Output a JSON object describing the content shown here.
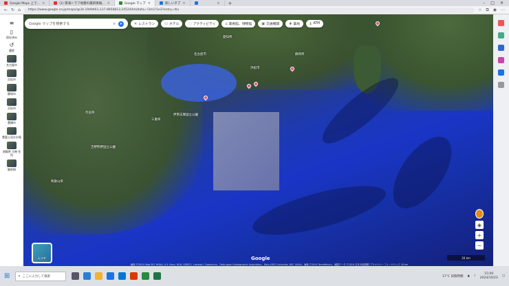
{
  "browser": {
    "tabs": [
      {
        "title": "Google Maps 上で…",
        "active": false,
        "color": "#d33333"
      },
      {
        "title": "(1) 南海トラフ地震の最新情報…",
        "active": false,
        "color": "#d33333"
      },
      {
        "title": "Google マップ",
        "active": true,
        "color": "#2b8a3e"
      },
      {
        "title": "新しいタブ",
        "active": false,
        "color": "#1a73e8"
      },
      {
        "title": "",
        "active": false,
        "color": "#1a73e8"
      }
    ],
    "new_tab": "+",
    "url": "https://www.google.co.jp/maps/@34.1949461,137.8958812,245244m/data=!3m1!1e3?entry=ttu",
    "nav": {
      "back": "←",
      "reload": "↻",
      "home": "⌂"
    },
    "window_controls": {
      "minimize": "–",
      "maximize": "□",
      "close": "✕"
    }
  },
  "sidebar": {
    "menu_icon": "≡",
    "items": [
      {
        "label": "保存済み",
        "icon": "bookmark"
      },
      {
        "label": "履歴",
        "icon": "history"
      },
      {
        "label": "名古屋市",
        "icon": "thumb"
      },
      {
        "label": "浜松市",
        "icon": "thumb"
      },
      {
        "label": "静岡市",
        "icon": "thumb"
      },
      {
        "label": "浜松市",
        "icon": "thumb"
      },
      {
        "label": "豊橋市",
        "icon": "thumb"
      },
      {
        "label": "豊富士見おお尾",
        "icon": "thumb"
      },
      {
        "label": "須賀原 大樹 住所",
        "icon": "thumb"
      },
      {
        "label": "御前崎",
        "icon": "thumb"
      }
    ]
  },
  "search": {
    "placeholder": "Google マップを検索する"
  },
  "chips": [
    {
      "label": "レストラン",
      "icon": "fork-knife-icon"
    },
    {
      "label": "ホテル",
      "icon": "bed-icon"
    },
    {
      "label": "アクティビティ",
      "icon": "activity-icon"
    },
    {
      "label": "美術館、博物館",
      "icon": "museum-icon"
    },
    {
      "label": "交通機関",
      "icon": "train-icon"
    },
    {
      "label": "薬局",
      "icon": "pharmacy-icon"
    },
    {
      "label": "ATM",
      "icon": "atm-icon"
    }
  ],
  "map": {
    "places": [
      {
        "name": "愛知県"
      },
      {
        "name": "静岡県"
      },
      {
        "name": "三重県"
      },
      {
        "name": "奈良県"
      },
      {
        "name": "和歌山県"
      },
      {
        "name": "伊勢志摩国立公園"
      },
      {
        "name": "吉野熊野国立公園"
      },
      {
        "name": "浜松市"
      },
      {
        "name": "名古屋市"
      }
    ],
    "layer_label": "レイヤ",
    "logo": "Google",
    "attribution": "画像 ©2024 Data SIO, NOAA, U.S. Navy, NGA, GEBCO、Landsat / Copernicus、Data Japan Hydrographic Association、Data LDEO-Columbia, NSF, NOAA、画像 ©2024 TerraMetrics、地図データ ©2024 日本 利用規約 プライバシー フィードバック 20 km",
    "scale": "20 km"
  },
  "taskbar": {
    "search_placeholder": "ここに入力して検索",
    "weather": "17°C 日照時間",
    "time": "15:00",
    "date": "2024/10/23"
  }
}
